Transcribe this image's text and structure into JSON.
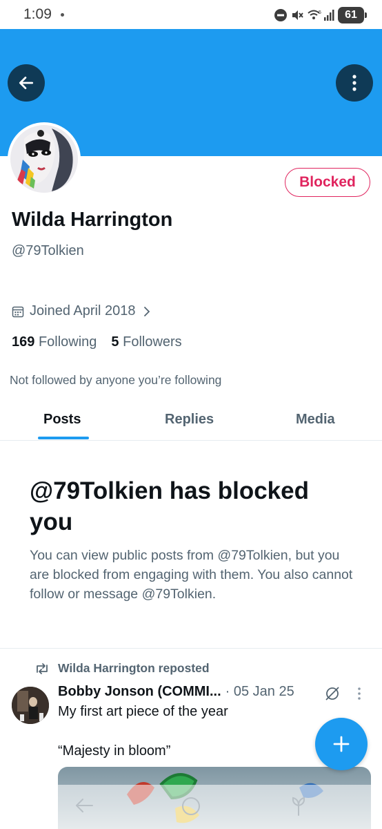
{
  "status_bar": {
    "time": "1:09",
    "battery": "61"
  },
  "profile": {
    "display_name": "Wilda Harrington",
    "handle": "@79Tolkien",
    "blocked_label": "Blocked",
    "joined": "Joined April 2018",
    "following_count": "169",
    "following_label": "Following",
    "followers_count": "5",
    "followers_label": "Followers",
    "not_followed_text": "Not followed by anyone you’re following"
  },
  "tabs": [
    {
      "label": "Posts",
      "active": true
    },
    {
      "label": "Replies",
      "active": false
    },
    {
      "label": "Media",
      "active": false
    }
  ],
  "blocked_notice": {
    "title": "@79Tolkien has blocked you",
    "description": "You can view public posts from @79Tolkien, but you are blocked from engaging with them. You also cannot follow or message @79Tolkien."
  },
  "post": {
    "repost_label": "Wilda Harrington reposted",
    "author": "Bobby Jonson (COMMI...",
    "date": "· 05 Jan 25",
    "text_line1": "My first art piece of the year",
    "text_line2": "“Majesty in bloom”"
  },
  "icons": {
    "back": "arrow-left-icon",
    "more": "more-vertical-icon",
    "calendar": "calendar-icon",
    "repost": "repost-icon",
    "grok": "grok-icon",
    "compose": "plus-icon",
    "nav_back": "nav-back-icon",
    "nav_home": "nav-home-icon",
    "nav_assistant": "nav-assistant-icon"
  },
  "colors": {
    "accent": "#1d9bf0",
    "blocked": "#e0245e",
    "secondary_text": "#536471"
  }
}
